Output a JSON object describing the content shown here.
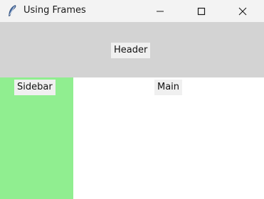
{
  "window": {
    "title": "Using Frames",
    "icon": "feather-icon",
    "controls": [
      "minimize-icon",
      "maximize-icon",
      "close-icon"
    ]
  },
  "header": {
    "label": "Header",
    "background": "#d3d3d3"
  },
  "sidebar": {
    "label": "Sidebar",
    "background": "#90ee90"
  },
  "main": {
    "label": "Main",
    "background": "#ffffff"
  }
}
